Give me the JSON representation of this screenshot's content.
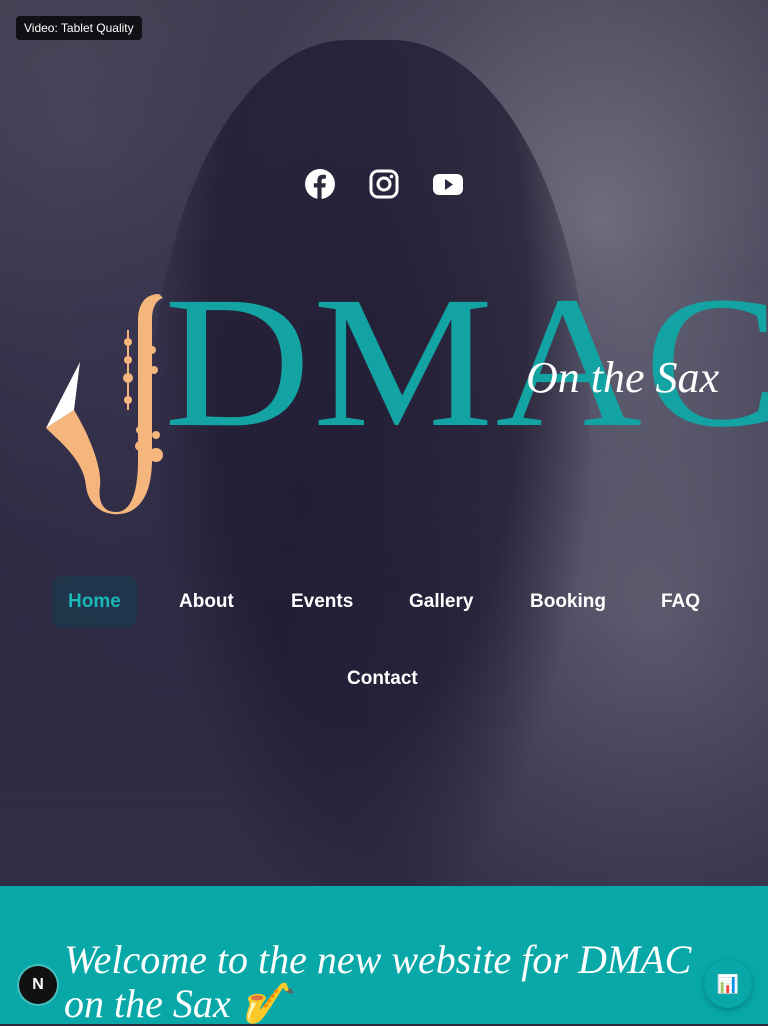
{
  "video_badge": "Video: Tablet Quality",
  "social": {
    "facebook": "facebook-icon",
    "instagram": "instagram-icon",
    "youtube": "youtube-icon"
  },
  "logo": {
    "title": "DMAC",
    "subtitle": "On the Sax"
  },
  "nav": {
    "items": [
      {
        "label": "Home",
        "active": true
      },
      {
        "label": "About"
      },
      {
        "label": "Events"
      },
      {
        "label": "Gallery"
      },
      {
        "label": "Booking"
      },
      {
        "label": "FAQ"
      },
      {
        "label": "Contact"
      }
    ]
  },
  "welcome": {
    "heading": "Welcome to the new website for DMAC on the Sax 🎷"
  },
  "floating": {
    "next_badge": "N",
    "chart_button": "📊"
  },
  "colors": {
    "accent": "#13a3a3",
    "welcome_bg": "#08a8a8",
    "nav_active": "#19b7b7",
    "sax": "#f4b67c"
  }
}
